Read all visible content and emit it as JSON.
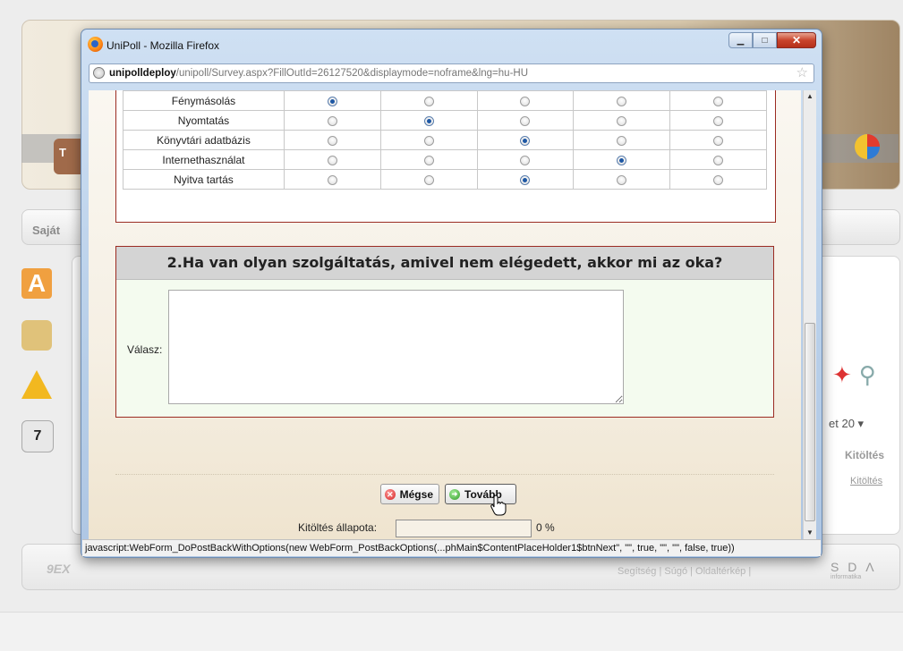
{
  "background": {
    "nav_label": "Saját",
    "logo_tab_letter": "T",
    "icon_a_letter": "A",
    "calendar_day": "7",
    "per_page_label": "et",
    "per_page_value": "20 ▾",
    "col_header": "Kitöltés",
    "col_link": "Kitöltés",
    "footer_left": "9EX",
    "footer_links": "Segítség | Súgó | Oldaltérkép |",
    "footer_brand": "S D Λ",
    "footer_brand_sub": "informatika"
  },
  "window": {
    "title": "UniPoll - Mozilla Firefox",
    "min_glyph": "▁",
    "max_glyph": "□",
    "close_glyph": "✕",
    "url_host": "unipolldeploy",
    "url_path": "/unipoll/Survey.aspx?FillOutId=26127520&displaymode=noframe&lng=hu-HU",
    "bookmark_glyph": "☆",
    "status_text": "javascript:WebForm_DoPostBackWithOptions(new WebForm_PostBackOptions(...phMain$ContentPlaceHolder1$btnNext\", \"\", true, \"\", \"\", false, true))"
  },
  "survey": {
    "matrix": {
      "rows": [
        {
          "label": "Fénymásolás",
          "selected": 0
        },
        {
          "label": "Nyomtatás",
          "selected": 1
        },
        {
          "label": "Könyvtári adatbázis",
          "selected": 2
        },
        {
          "label": "Internethasználat",
          "selected": 3
        },
        {
          "label": "Nyitva tartás",
          "selected": 2
        }
      ],
      "option_count": 5
    },
    "question2": {
      "title": "2.Ha van olyan szolgáltatás, amivel nem elégedett, akkor mi az oka?",
      "answer_label": "Válasz:",
      "answer_value": ""
    },
    "buttons": {
      "cancel_label": "Mégse",
      "next_label": "Tovább"
    },
    "progress": {
      "label": "Kitöltés állapota:",
      "value": 0,
      "percent_text": "0 %"
    }
  }
}
